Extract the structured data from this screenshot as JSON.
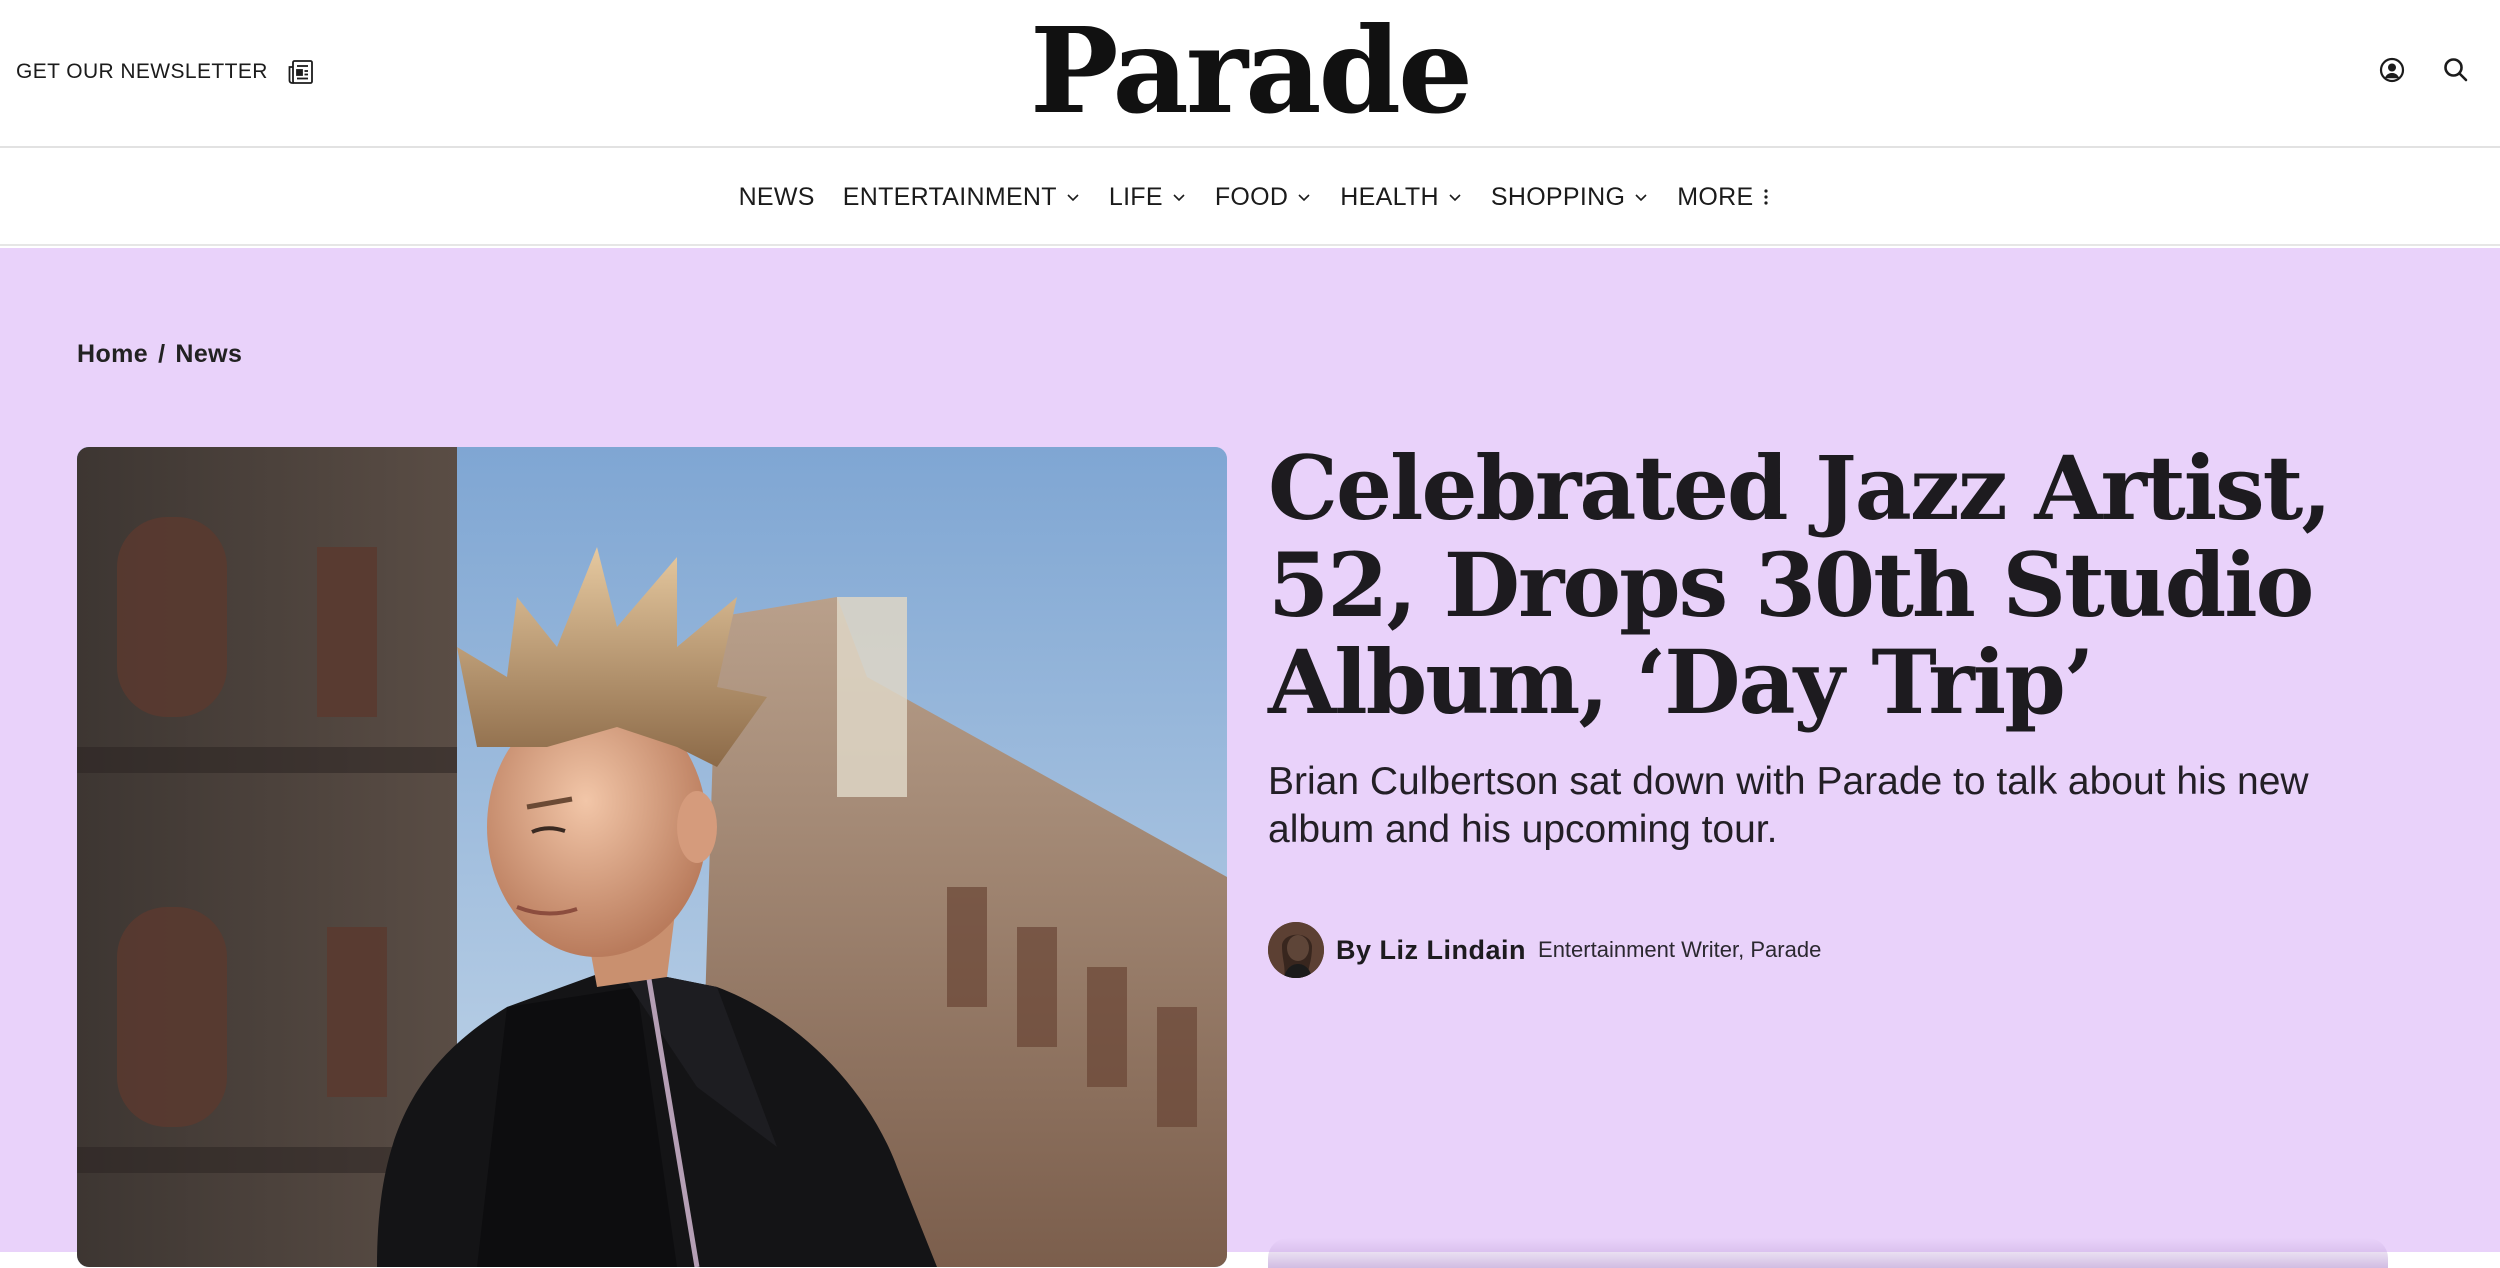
{
  "header": {
    "newsletter_label": "GET OUR NEWSLETTER",
    "newsletter_icon": "newspaper-icon",
    "logo": "Parade",
    "account_icon": "user-circle-icon",
    "search_icon": "search-icon"
  },
  "nav": {
    "items": [
      {
        "label": "NEWS",
        "has_dropdown": false
      },
      {
        "label": "ENTERTAINMENT",
        "has_dropdown": true
      },
      {
        "label": "LIFE",
        "has_dropdown": true
      },
      {
        "label": "FOOD",
        "has_dropdown": true
      },
      {
        "label": "HEALTH",
        "has_dropdown": true
      },
      {
        "label": "SHOPPING",
        "has_dropdown": true
      },
      {
        "label": "MORE",
        "has_dropdown": false,
        "icon": "kebab-icon"
      }
    ]
  },
  "breadcrumb": {
    "home": "Home",
    "separator": "/",
    "section": "News"
  },
  "article": {
    "headline": "Celebrated Jazz Artist, 52, Drops 30th Studio Album, ‘Day Trip’",
    "dek": "Brian Culbertson sat down with Parade to talk about his new album and his upcoming tour.",
    "byline_prefix": "By",
    "author": "Liz Lindain",
    "author_role": "Entertainment Writer, Parade"
  },
  "colors": {
    "hero_background": "#e9d2fa",
    "text": "#1d1b1f"
  }
}
